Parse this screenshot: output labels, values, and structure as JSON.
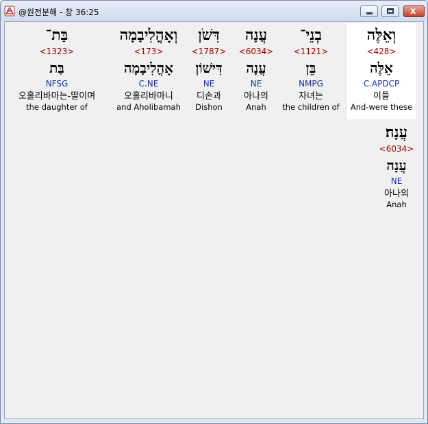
{
  "window": {
    "title": "@원전분해 - 창 36:25",
    "minimize_label": "",
    "maximize_label": "",
    "close_label": "x"
  },
  "words": [
    {
      "hebrew": "וְאֵלֶּה",
      "strong": "<428>",
      "lemma": "אֵלֶּה",
      "morph": "C.APDCP",
      "korean": "이들",
      "english": "And-were these"
    },
    {
      "hebrew": "בְנֵי־",
      "strong": "<1121>",
      "lemma": "בֵּן",
      "morph": "NMPG",
      "korean": "자녀는",
      "english": "the children of"
    },
    {
      "hebrew": "עֲנָה",
      "strong": "<6034>",
      "lemma": "עֲנָה",
      "morph": "NE",
      "korean": "아나의",
      "english": "Anah"
    },
    {
      "hebrew": "דִּשֹׁן",
      "strong": "<1787>",
      "lemma": "דִּישׁוֹן",
      "morph": "NE",
      "korean": "디손과",
      "english": "Dishon"
    },
    {
      "hebrew": "וְאָהֳלִיבָמָה",
      "strong": "<173>",
      "lemma": "אָהֳלִיבָמָה",
      "morph": "C.NE",
      "korean": "오홀리바마니",
      "english": "and Aholibamah"
    },
    {
      "hebrew": "בַּת־",
      "strong": "<1323>",
      "lemma": "בַּת",
      "morph": "NFSG",
      "korean": "오홀리바마는-딸이며",
      "english": "the daughter of"
    },
    {
      "hebrew": "עֲנָה׃",
      "strong": "<6034>",
      "lemma": "עֲנָה",
      "morph": "NE",
      "korean": "아나의",
      "english": "Anah"
    }
  ]
}
